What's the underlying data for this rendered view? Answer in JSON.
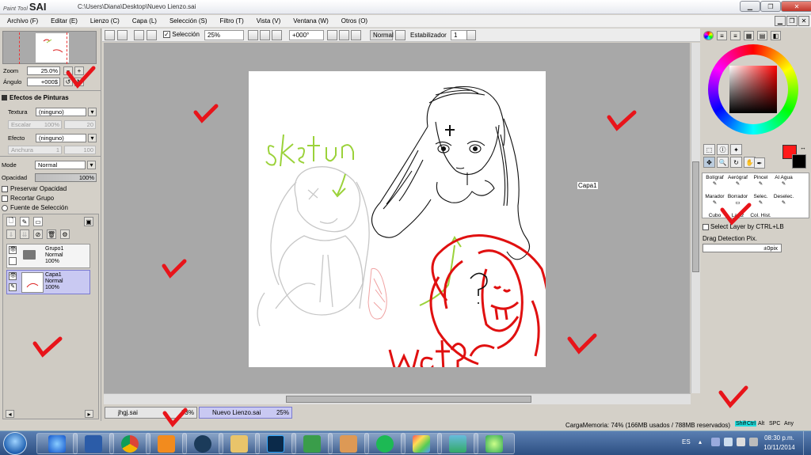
{
  "window": {
    "app_logo_small": "Paint Tool",
    "app_logo_big": "SAI",
    "file_path": "C:\\Users\\Diana\\Desktop\\Nuevo Lienzo.sai"
  },
  "menu": [
    "Archivo (F)",
    "Editar (E)",
    "Lienzo (C)",
    "Capa (L)",
    "Selección (S)",
    "Filtro (T)",
    "Vista (V)",
    "Ventana (W)",
    "Otros (O)"
  ],
  "navigator": {
    "zoom_label": "Zoom",
    "zoom_value": "25.0%",
    "angle_label": "Ángulo",
    "angle_value": "+000$"
  },
  "effects": {
    "header": "Efectos de Pinturas",
    "texture_label": "Textura",
    "texture_value": "(ninguno)",
    "scale_label": "Escalar",
    "scale_value": "100%",
    "scale_num": "20",
    "effect_label": "Efecto",
    "effect_value": "(ninguno)",
    "width_label": "Anchura",
    "width_value": "1",
    "width_num": "100"
  },
  "layer_props": {
    "mode_label": "Mode",
    "mode_value": "Normal",
    "opacity_label": "Opacidad",
    "opacity_value": "100%",
    "preserve_opacity": "Preservar Opacidad",
    "clip_group": "Recortar Grupo",
    "selection_source": "Fuente de Selección"
  },
  "layers": [
    {
      "name": "Grupo1",
      "mode": "Normal",
      "opacity": "100%",
      "selected": false
    },
    {
      "name": "Capa1",
      "mode": "Normal",
      "opacity": "100%",
      "selected": true
    }
  ],
  "toolbar": {
    "selection_label": "Selección",
    "zoom": "25%",
    "angle": "+000°",
    "mode": "Normal",
    "stabilizer_label": "Estabilizador",
    "stabilizer_value": "1"
  },
  "canvas": {
    "floating_label": "Capa1",
    "sketch_text": "sketch",
    "wat_text": "wat?"
  },
  "tools": {
    "row1": [
      "Bolígraf",
      "Aerógraf",
      "Pincel",
      "Al Agua"
    ],
    "row2": [
      "Marador",
      "Borrador",
      "Selec.",
      "Deselec."
    ],
    "row3": [
      "Cubo",
      "Lapiz",
      "Col. Hist."
    ],
    "select_layer_label": "Select Layer by CTRL+LB",
    "drag_label": "Drag Detection Pix.",
    "drag_value": "±0pix"
  },
  "colors": {
    "main": "#ff1a1a",
    "secondary": "#000000",
    "accent_check": "#e8141a",
    "sketch_green": "#9bd23a",
    "drawing_red": "#e01010"
  },
  "doc_tabs": [
    {
      "name": "jhgj.sai",
      "zoom": "33%",
      "active": false
    },
    {
      "name": "Nuevo Lienzo.sai",
      "zoom": "25%",
      "active": true
    }
  ],
  "status": {
    "memory": "CargaMemoria: 74% (166MB usados / 788MB reservados)",
    "keys": [
      "Shift",
      "Ctrl",
      "Alt",
      "SPC",
      "Any"
    ]
  },
  "taskbar": {
    "language": "ES",
    "time": "08:30 p.m.",
    "date": "10/11/2014",
    "apps": [
      "Internet Explorer",
      "Word",
      "Chrome",
      "Media",
      "Steam",
      "Explorer",
      "Photoshop",
      "HP",
      "Folder",
      "Spotify",
      "Paint",
      "Gallery",
      "Games"
    ]
  }
}
